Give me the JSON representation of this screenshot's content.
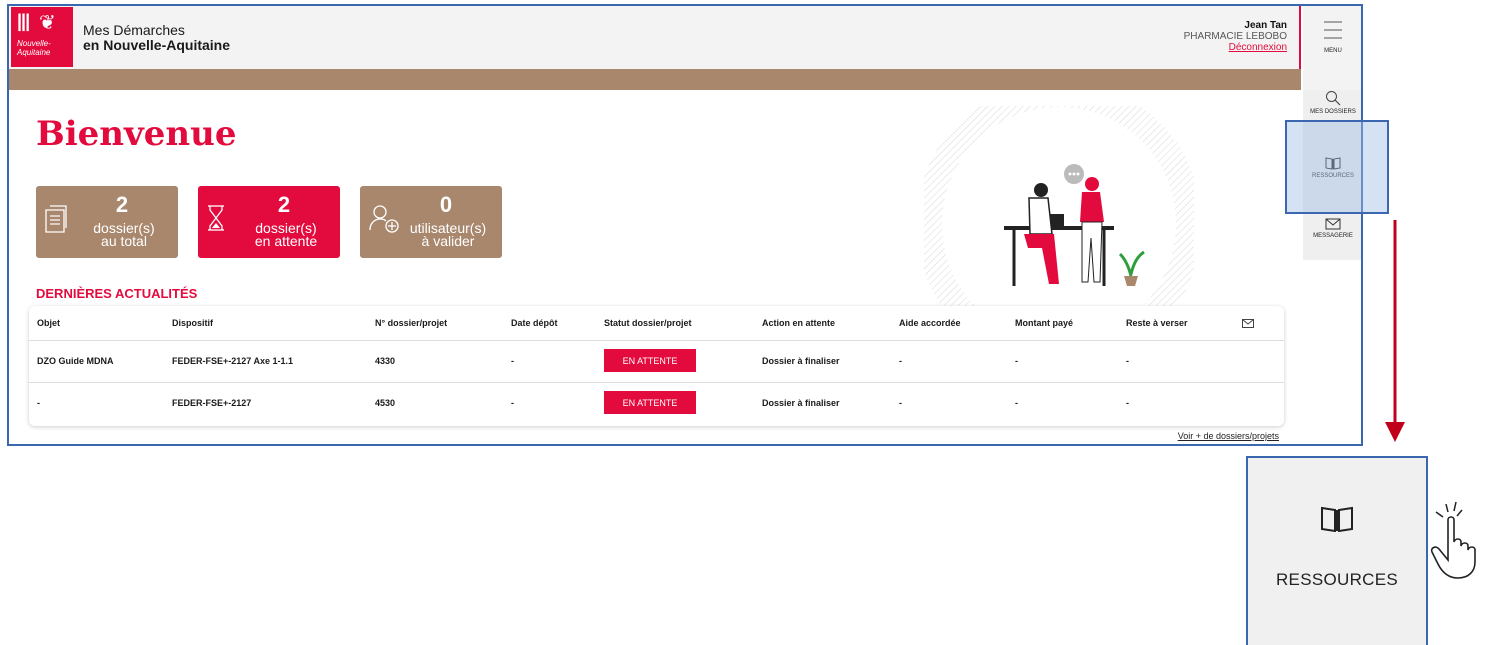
{
  "brand": {
    "logo_line1": "Nouvelle-",
    "logo_line2": "Aquitaine",
    "title_line1": "Mes Démarches",
    "title_line2": "en Nouvelle-Aquitaine"
  },
  "user": {
    "name": "Jean Tan",
    "organisation": "PHARMACIE LEBOBO",
    "logout": "Déconnexion"
  },
  "sidebar": {
    "menu_label": "MENU",
    "items": [
      {
        "label": "MES DOSSIERS",
        "icon": "search-icon"
      },
      {
        "label": "RESSOURCES",
        "icon": "book-icon"
      },
      {
        "label": "MESSAGERIE",
        "icon": "envelope-icon"
      }
    ]
  },
  "welcome": "Bienvenue",
  "cards": [
    {
      "number": "2",
      "label_line1": "dossier(s)",
      "label_line2": "au total",
      "icon": "document-icon",
      "color": "#a8876d"
    },
    {
      "number": "2",
      "label_line1": "dossier(s)",
      "label_line2": "en attente",
      "icon": "hourglass-icon",
      "color": "#e30b3e"
    },
    {
      "number": "0",
      "label_line1": "utilisateur(s)",
      "label_line2": "à valider",
      "icon": "add-user-icon",
      "color": "#a8876d"
    }
  ],
  "news": {
    "title": "DERNIÈRES ACTUALITÉS",
    "columns": [
      "Objet",
      "Dispositif",
      "N° dossier/projet",
      "Date dépôt",
      "Statut dossier/projet",
      "Action en attente",
      "Aide accordée",
      "Montant payé",
      "Reste à verser"
    ],
    "rows": [
      [
        "DZO Guide MDNA",
        "FEDER-FSE+-2127 Axe 1-1.1",
        "4330",
        "-",
        "EN ATTENTE",
        "Dossier à finaliser",
        "-",
        "-",
        "-"
      ],
      [
        "-",
        "FEDER-FSE+-2127",
        "4530",
        "-",
        "EN ATTENTE",
        "Dossier à finaliser",
        "-",
        "-",
        "-"
      ]
    ],
    "more_link": "Voir + de dossiers/projets"
  },
  "zoom": {
    "label": "RESSOURCES"
  },
  "colors": {
    "accent": "#e30b3e",
    "brown": "#a8876d",
    "frame": "#3a67b0"
  }
}
